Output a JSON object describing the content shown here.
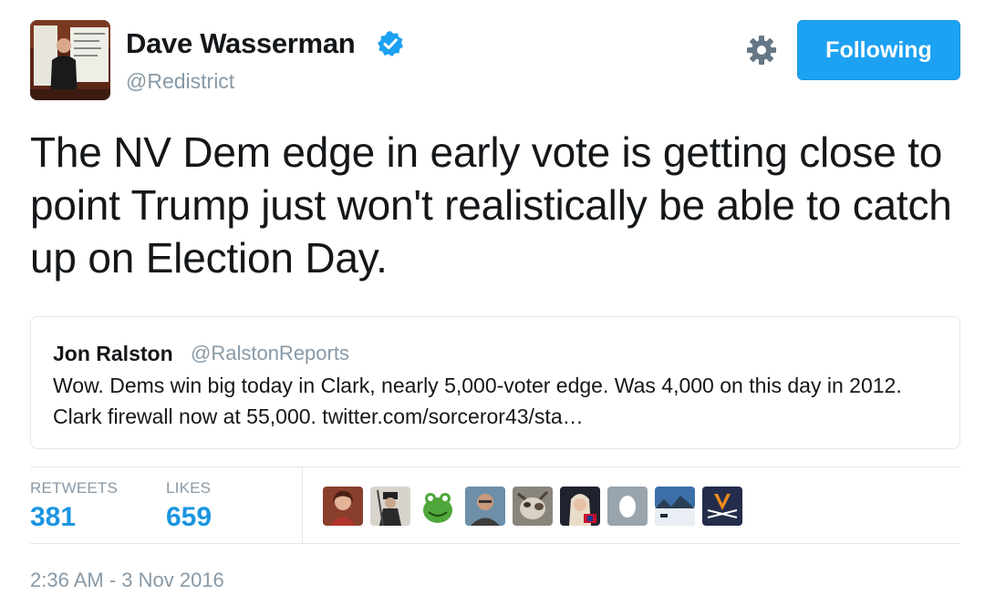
{
  "author": {
    "name": "Dave Wasserman",
    "handle": "@Redistrict",
    "verified": true,
    "verified_icon": "verified-badge-icon"
  },
  "actions": {
    "settings_icon": "gear-icon",
    "follow_label": "Following"
  },
  "tweet": {
    "text": "The NV Dem edge in early vote is getting close to point Trump just won't realistically be able to catch up on Election Day."
  },
  "quoted_tweet": {
    "name": "Jon Ralston",
    "handle": "@RalstonReports",
    "text": "Wow. Dems win big today in Clark, nearly 5,000-voter edge. Was 4,000 on this day in 2012. Clark firewall now at 55,000. twitter.com/sorceror43/sta…"
  },
  "stats": {
    "retweets_label": "RETWEETS",
    "retweets_value": "381",
    "likes_label": "LIKES",
    "likes_value": "659"
  },
  "likers": [
    "woman-avatar",
    "soldier-avatar",
    "frog-avatar",
    "man-avatar",
    "animal-avatar",
    "woman-portrait-avatar",
    "default-egg-avatar",
    "landscape-avatar",
    "virginia-logo-avatar"
  ],
  "timestamp": "2:36 AM - 3 Nov 2016",
  "colors": {
    "accent": "#1da1f2",
    "stat_value": "#1b95e0",
    "secondary_text": "#8899a6"
  }
}
